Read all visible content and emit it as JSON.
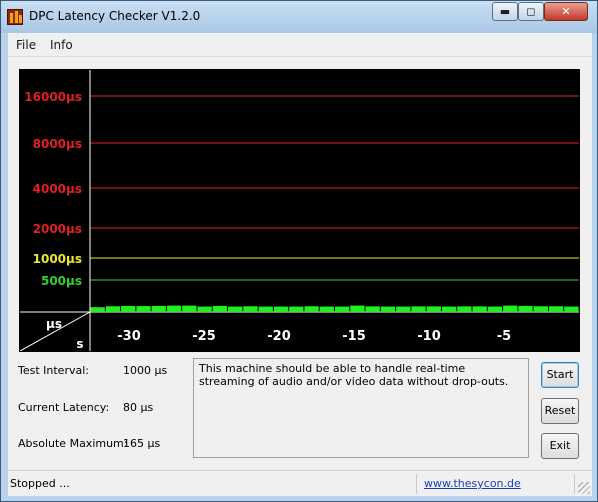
{
  "window": {
    "title": "DPC Latency Checker V1.2.0",
    "controls": {
      "minimize": "▬",
      "maximize": "◻",
      "close": "✕"
    }
  },
  "menu": {
    "file": "File",
    "info": "Info"
  },
  "graph": {
    "unit_y": "µs",
    "unit_x": "s",
    "y_levels": [
      {
        "label": "16000µs",
        "color": "#e02020"
      },
      {
        "label": "8000µs",
        "color": "#e02020"
      },
      {
        "label": "4000µs",
        "color": "#e02020"
      },
      {
        "label": "2000µs",
        "color": "#e02020"
      },
      {
        "label": "1000µs",
        "color": "#e8e830"
      },
      {
        "label": "500µs",
        "color": "#30d030"
      }
    ],
    "x_ticks": [
      "-30",
      "-25",
      "-20",
      "-15",
      "-10",
      "-5"
    ],
    "bar_color": "#22ee22"
  },
  "chart_data": {
    "type": "bar",
    "xlabel": "s",
    "ylabel": "µs",
    "ylim": [
      0,
      16000
    ],
    "x": [
      -32,
      -31,
      -30,
      -29,
      -28,
      -27,
      -26,
      -25,
      -24,
      -23,
      -22,
      -21,
      -20,
      -19,
      -18,
      -17,
      -16,
      -15,
      -14,
      -13,
      -12,
      -11,
      -10,
      -9,
      -8,
      -7,
      -6,
      -5,
      -4,
      -3,
      -2,
      -1
    ],
    "values": [
      75,
      90,
      95,
      92,
      95,
      100,
      100,
      85,
      95,
      85,
      90,
      85,
      85,
      85,
      90,
      85,
      85,
      100,
      88,
      85,
      85,
      88,
      88,
      85,
      88,
      88,
      85,
      100,
      95,
      90,
      90,
      85
    ]
  },
  "info": {
    "test_interval_label": "Test Interval:",
    "test_interval_value": "1000 µs",
    "current_latency_label": "Current Latency:",
    "current_latency_value": "80 µs",
    "absolute_max_label": "Absolute Maximum:",
    "absolute_max_value": "165 µs",
    "message": "This machine should be able to handle real-time streaming of audio and/or video data without drop-outs."
  },
  "buttons": {
    "start": "Start",
    "reset": "Reset",
    "exit": "Exit"
  },
  "status": {
    "text": "Stopped ...",
    "link": "www.thesycon.de"
  }
}
